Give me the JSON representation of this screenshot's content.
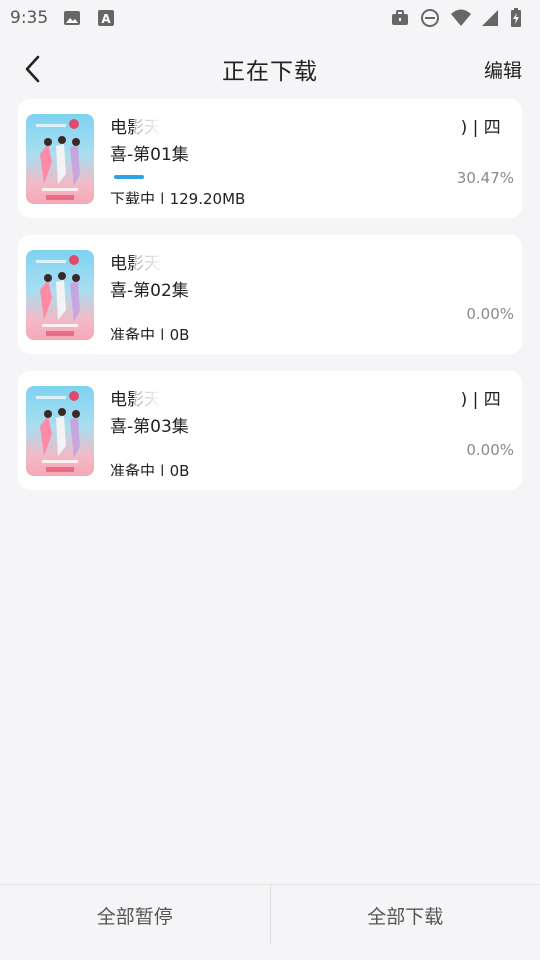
{
  "status_bar": {
    "time": "9:35",
    "icons_left": [
      "image-icon",
      "text-a-icon"
    ],
    "icons_right": [
      "briefcase-icon",
      "do-not-disturb-icon",
      "wifi-icon",
      "signal-icon",
      "battery-icon"
    ]
  },
  "header": {
    "title": "正在下载",
    "edit_label": "编辑",
    "back_icon": "chevron-left-icon"
  },
  "downloads": [
    {
      "title": "电影天堂(",
      "title_suffix": ") | 四",
      "title_line2": "喜-第01集",
      "progress": 0.3047,
      "percent": "30.47%",
      "status": "下载中 | 129.20MB"
    },
    {
      "title": "电影天堂(",
      "title_suffix": "",
      "title_line2": "喜-第02集",
      "progress": 0,
      "percent": "0.00%",
      "status": "准备中 | 0B"
    },
    {
      "title": "电影天堂(",
      "title_suffix": ") | 四",
      "title_line2": "喜-第03集",
      "progress": 0,
      "percent": "0.00%",
      "status": "准备中 | 0B"
    }
  ],
  "bottom": {
    "pause_all": "全部暂停",
    "download_all": "全部下载"
  },
  "colors": {
    "accent": "#2aa3e8",
    "background": "#f5f5f7",
    "card": "#ffffff"
  }
}
